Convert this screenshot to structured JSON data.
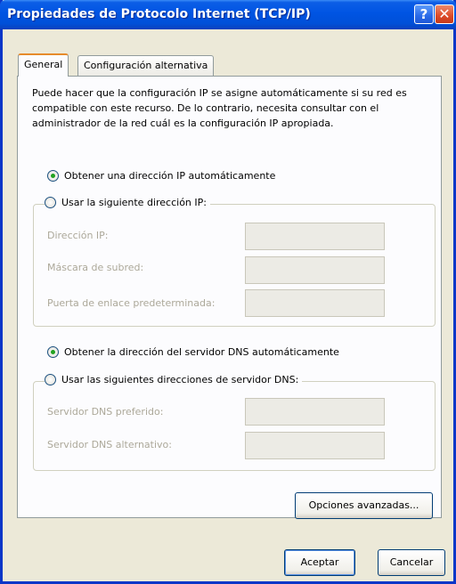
{
  "window": {
    "title": "Propiedades de Protocolo Internet (TCP/IP)",
    "help_glyph": "?",
    "close_glyph": "✕"
  },
  "tabs": [
    {
      "label": "General",
      "active": true
    },
    {
      "label": "Configuración alternativa",
      "active": false
    }
  ],
  "intro_text": "Puede hacer que la configuración IP se asigne automáticamente si su red es compatible con este recurso. De lo contrario, necesita consultar con el administrador de la red cuál es la configuración IP apropiada.",
  "ip": {
    "auto_label": "Obtener una dirección IP automáticamente",
    "manual_label": "Usar la siguiente dirección IP:",
    "selected": "auto",
    "fields": [
      {
        "label": "Dirección IP:",
        "value": ""
      },
      {
        "label": "Máscara de subred:",
        "value": ""
      },
      {
        "label": "Puerta de enlace predeterminada:",
        "value": ""
      }
    ]
  },
  "dns": {
    "auto_label": "Obtener la dirección del servidor DNS automáticamente",
    "manual_label": "Usar las siguientes direcciones de servidor DNS:",
    "selected": "auto",
    "fields": [
      {
        "label": "Servidor DNS preferido:",
        "value": ""
      },
      {
        "label": "Servidor DNS alternativo:",
        "value": ""
      }
    ]
  },
  "buttons": {
    "advanced": "Opciones avanzadas...",
    "ok": "Aceptar",
    "cancel": "Cancelar"
  },
  "colors": {
    "titlebar": "#0054e3",
    "dialog_bg": "#ece9d8",
    "selected_radio": "#21a121",
    "active_tab_accent": "#e68b2c"
  }
}
